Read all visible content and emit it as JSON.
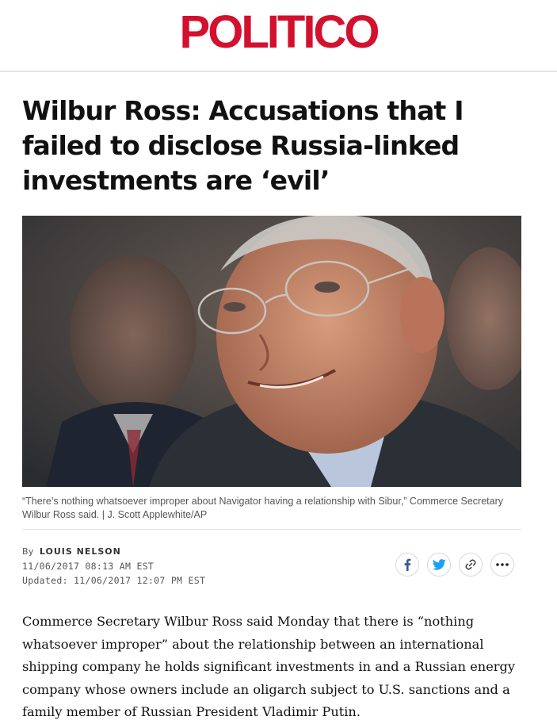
{
  "masthead": {
    "logo_text": "POLITICO",
    "brand_color": "#d2112e"
  },
  "article": {
    "headline": "Wilbur Ross: Accusations that I failed to disclose Russia-linked investments are ‘evil’",
    "photo_caption": "“There’s nothing whatsoever improper about Navigator having a relationship with Sibur,” Commerce Secretary Wilbur Ross said. | J. Scott Applewhite/AP",
    "byline_prefix": "By",
    "author": "LOUIS NELSON",
    "published": "11/06/2017 08:13 AM EST",
    "updated_label": "Updated:",
    "updated": "11/06/2017 12:07 PM EST",
    "body": "Commerce Secretary Wilbur Ross said Monday that there is “nothing whatsoever improper” about the relationship between an international shipping company he holds significant investments in and a Russian energy company whose owners include an oligarch subject to U.S. sanctions and a family member of Russian President Vladimir Putin."
  },
  "share": {
    "icons": [
      "facebook-icon",
      "twitter-icon",
      "link-icon",
      "more-icon"
    ],
    "facebook_color": "#3b5998",
    "twitter_color": "#1da1f2"
  }
}
